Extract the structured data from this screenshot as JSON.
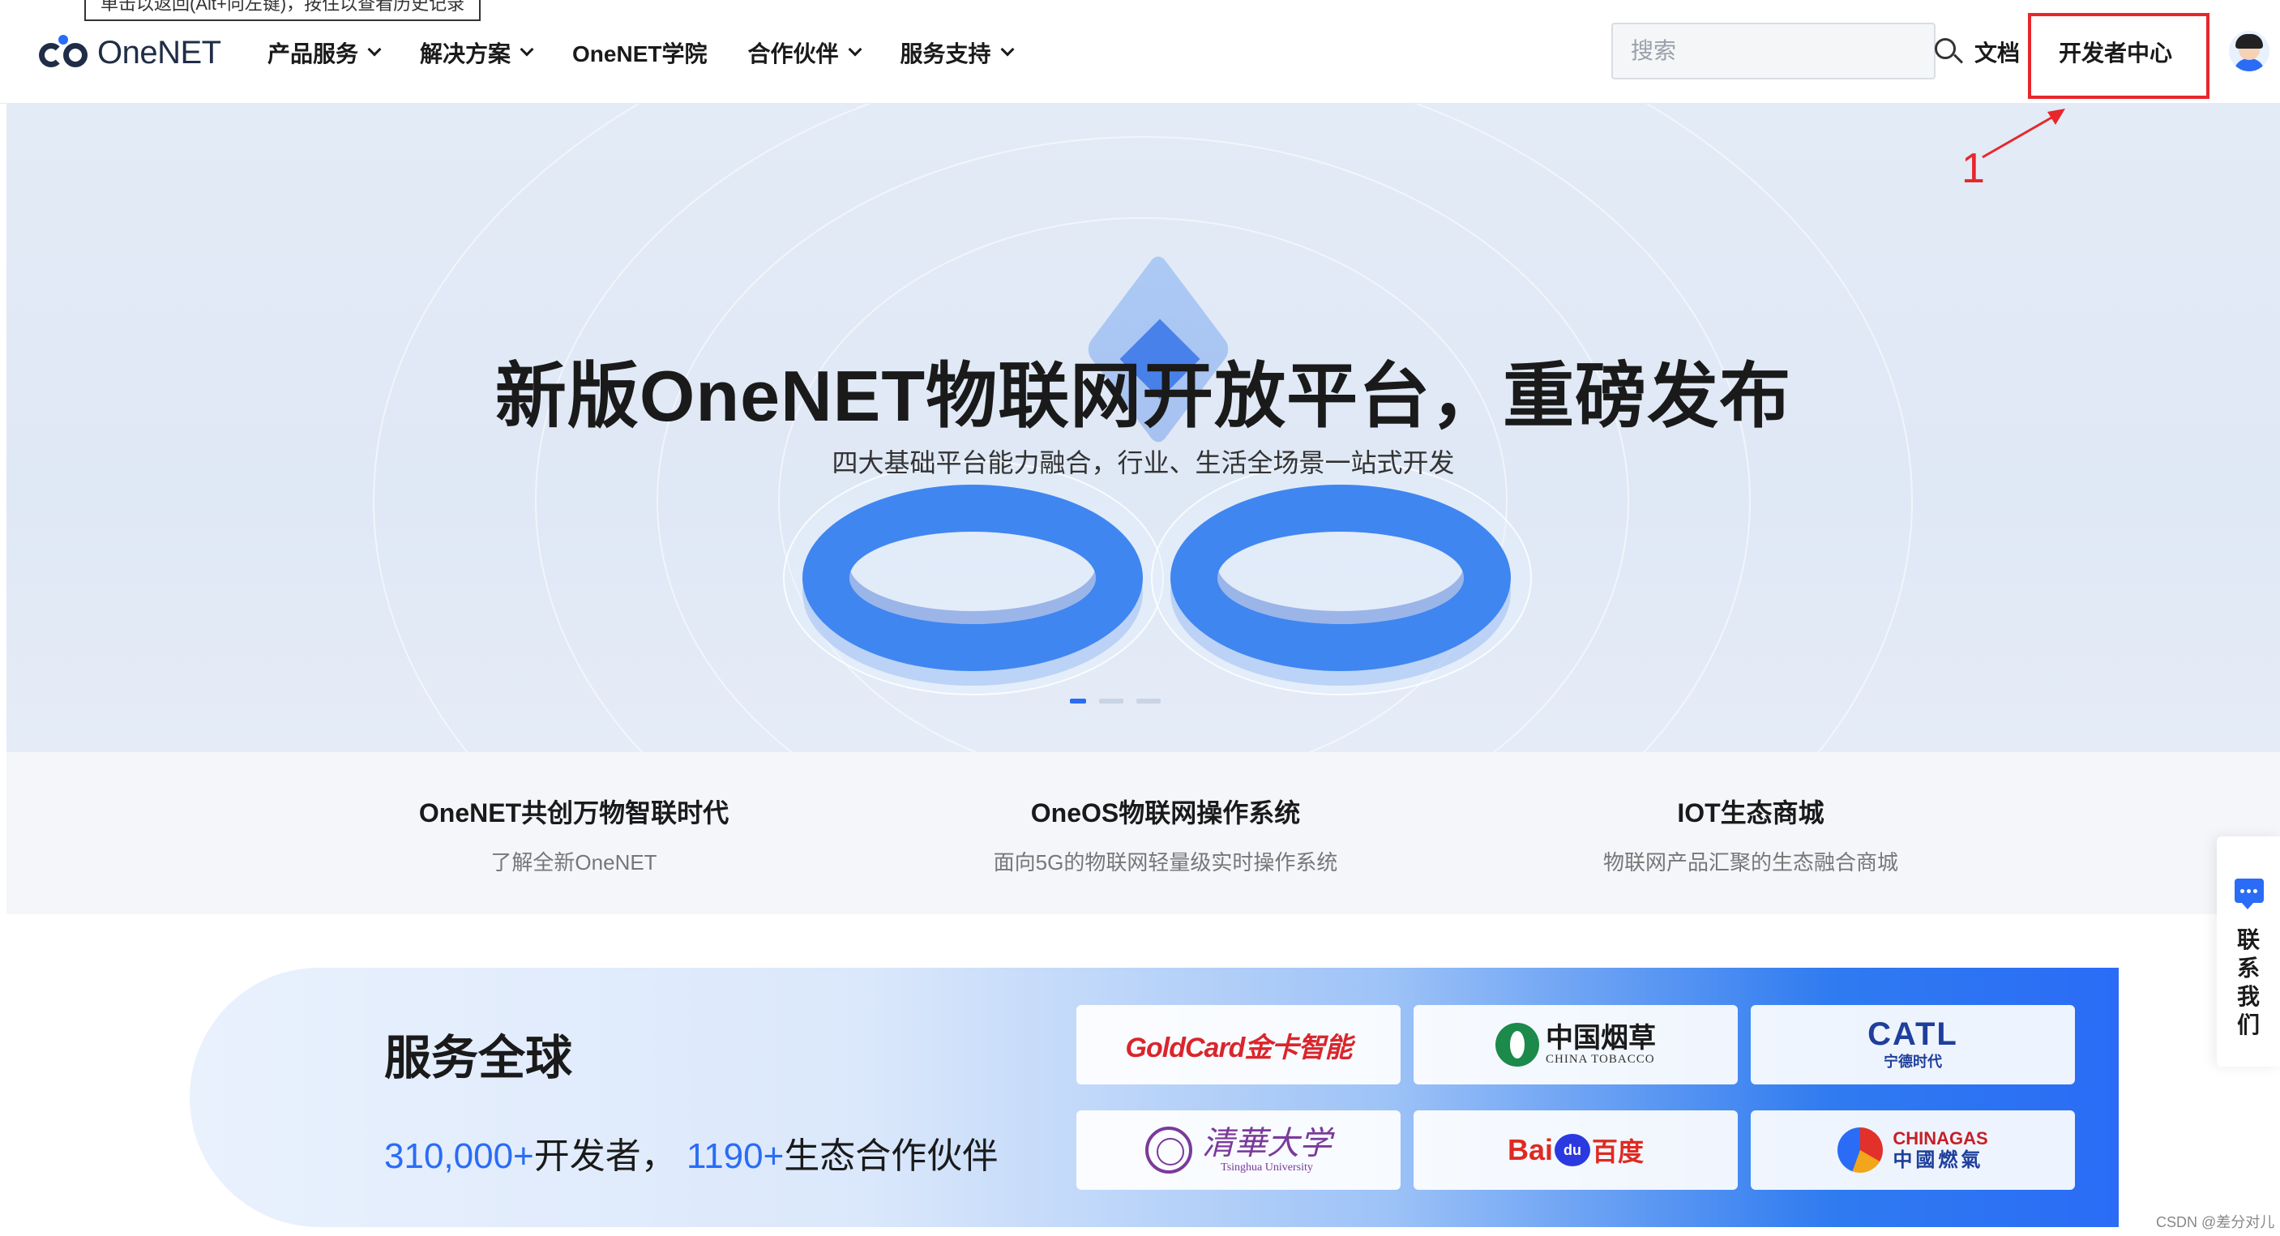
{
  "tooltip": {
    "text": "单击以返回(Alt+向左键)，按住以查看历史记录"
  },
  "header": {
    "logo_text": "OneNET",
    "nav": [
      {
        "label": "产品服务",
        "dropdown": true
      },
      {
        "label": "解决方案",
        "dropdown": true
      },
      {
        "label": "OneNET学院",
        "dropdown": false
      },
      {
        "label": "合作伙伴",
        "dropdown": true
      },
      {
        "label": "服务支持",
        "dropdown": true
      }
    ],
    "search_placeholder": "搜索",
    "docs_label": "文档",
    "dev_center_label": "开发者中心"
  },
  "annotation": {
    "number": "1",
    "color": "#e8262b"
  },
  "hero": {
    "title": "新版OneNET物联网开放平台，重磅发布",
    "subtitle": "四大基础平台能力融合，行业、生活全场景一站式开发",
    "active_slide": 1,
    "slide_count": 3
  },
  "features": [
    {
      "title": "OneNET共创万物智联时代",
      "desc": "了解全新OneNET"
    },
    {
      "title": "OneOS物联网操作系统",
      "desc": "面向5G的物联网轻量级实时操作系统"
    },
    {
      "title": "IOT生态商城",
      "desc": "物联网产品汇聚的生态融合商城"
    }
  ],
  "contact": {
    "label": "联系我们"
  },
  "global": {
    "title": "服务全球",
    "dev_count": "310,000+",
    "dev_label": "开发者，",
    "partner_count": "1190+",
    "partner_label": "生态合作伙伴",
    "partners": {
      "goldcard": "GoldCard金卡智能",
      "tobacco_zh": "中国烟草",
      "tobacco_en": "CHINA TOBACCO",
      "catl_en": "CATL",
      "catl_zh": "宁德时代",
      "tsinghua_zh": "清華大学",
      "tsinghua_en": "Tsinghua University",
      "baidu_bai": "Bai",
      "baidu_du": "du",
      "baidu_zh": "百度",
      "chinagas_en": "CHINAGAS",
      "chinagas_zh": "中國燃氣"
    }
  },
  "colors": {
    "accent": "#2a6cf6",
    "highlight_box": "#e8262b"
  },
  "watermark": "CSDN @差分对儿"
}
